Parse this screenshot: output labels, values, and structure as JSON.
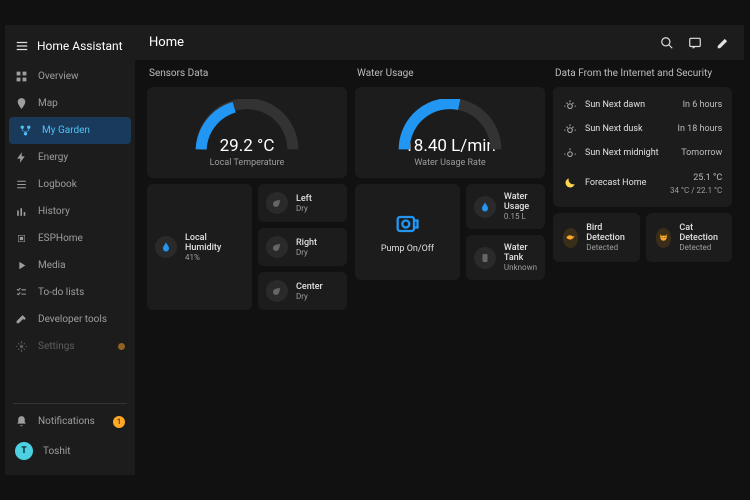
{
  "sidebar": {
    "title": "Home Assistant",
    "items": [
      {
        "label": "Overview"
      },
      {
        "label": "Map"
      },
      {
        "label": "My Garden"
      },
      {
        "label": "Energy"
      },
      {
        "label": "Logbook"
      },
      {
        "label": "History"
      },
      {
        "label": "ESPHome"
      },
      {
        "label": "Media"
      },
      {
        "label": "To-do lists"
      },
      {
        "label": "Developer tools"
      },
      {
        "label": "Settings"
      }
    ],
    "notifications": "Notifications",
    "user": "Toshit",
    "user_initial": "T"
  },
  "header": {
    "title": "Home"
  },
  "sections": {
    "sensors": "Sensors Data",
    "water": "Water Usage",
    "internet": "Data From the Internet and Security"
  },
  "sensors": {
    "temp_value": "29.2 °C",
    "temp_label": "Local Temperature",
    "humidity_name": "Local Humidity",
    "humidity_val": "41%",
    "zones": [
      {
        "name": "Left",
        "val": "Dry"
      },
      {
        "name": "Right",
        "val": "Dry"
      },
      {
        "name": "Center",
        "val": "Dry"
      }
    ]
  },
  "water": {
    "rate_value": "18.40 L/min",
    "rate_label": "Water Usage Rate",
    "pump_label": "Pump On/Off",
    "usage_name": "Water Usage",
    "usage_val": "0.15 L",
    "tank_name": "Water Tank",
    "tank_val": "Unknown"
  },
  "internet": {
    "rows": [
      {
        "name": "Sun Next dawn",
        "val": "In 6 hours"
      },
      {
        "name": "Sun Next dusk",
        "val": "In 18 hours"
      },
      {
        "name": "Sun Next midnight",
        "val": "Tomorrow"
      }
    ],
    "forecast_name": "Forecast Home",
    "forecast_temp": "25.1 °C",
    "forecast_range": "34 °C / 22.1 °C",
    "bird_name": "Bird Detection",
    "bird_val": "Detected",
    "cat_name": "Cat Detection",
    "cat_val": "Detected"
  }
}
